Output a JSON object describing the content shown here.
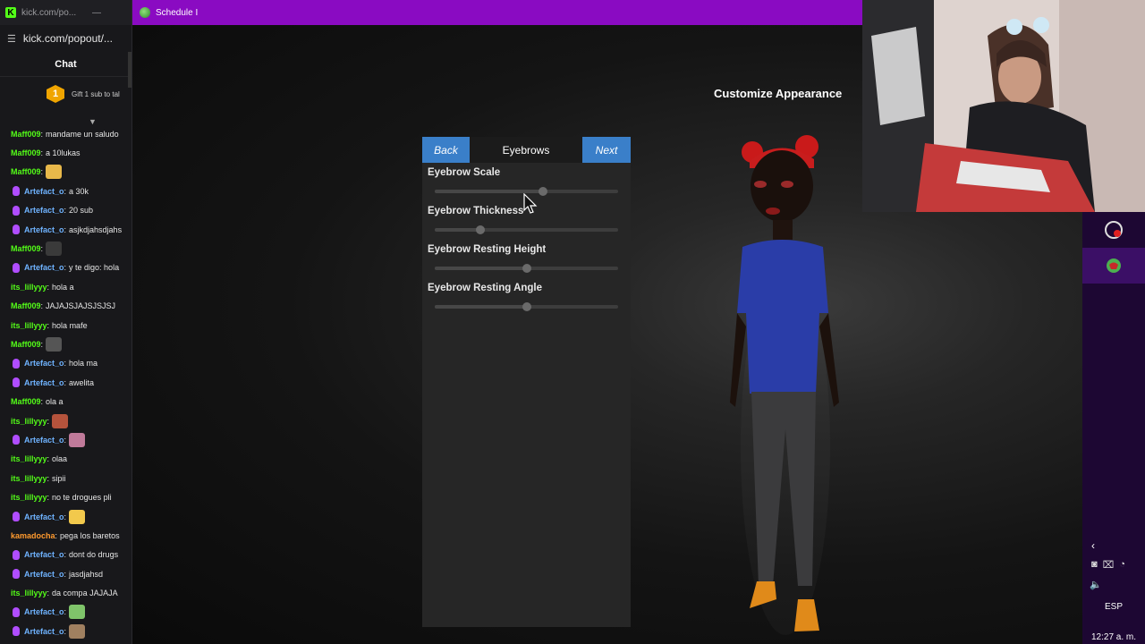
{
  "chat_window": {
    "title": "kick.com/po...",
    "minimize": "—",
    "url": "kick.com/popout/...",
    "header": "Chat",
    "gift": {
      "count": "1",
      "text": "Gift 1 sub to tal"
    },
    "messages": [
      {
        "user": "Maff009",
        "color": "#53fc18",
        "mic": false,
        "text": "mandame un saludo",
        "emote": null
      },
      {
        "user": "Maff009",
        "color": "#53fc18",
        "mic": false,
        "text": "a 10lukas",
        "emote": null
      },
      {
        "user": "Maff009",
        "color": "#53fc18",
        "mic": false,
        "text": "",
        "emote": "#e8b84a"
      },
      {
        "user": "Artefact_o",
        "color": "#6fb3ff",
        "mic": true,
        "text": "a 30k",
        "emote": null
      },
      {
        "user": "Artefact_o",
        "color": "#6fb3ff",
        "mic": true,
        "text": "20 sub",
        "emote": null
      },
      {
        "user": "Artefact_o",
        "color": "#6fb3ff",
        "mic": true,
        "text": "asjkdjahsdjahs",
        "emote": null
      },
      {
        "user": "Maff009",
        "color": "#53fc18",
        "mic": false,
        "text": "",
        "emote": "#3a3a3a"
      },
      {
        "user": "Artefact_o",
        "color": "#6fb3ff",
        "mic": true,
        "text": "y te digo: hola",
        "emote": null
      },
      {
        "user": "its_lillyyy",
        "color": "#53fc18",
        "mic": false,
        "text": "hola a",
        "emote": null
      },
      {
        "user": "Maff009",
        "color": "#53fc18",
        "mic": false,
        "text": "JAJAJSJAJSJSJSJ",
        "emote": null
      },
      {
        "user": "its_lillyyy",
        "color": "#53fc18",
        "mic": false,
        "text": "hola mafe",
        "emote": null
      },
      {
        "user": "Maff009",
        "color": "#53fc18",
        "mic": false,
        "text": "",
        "emote": "#555555"
      },
      {
        "user": "Artefact_o",
        "color": "#6fb3ff",
        "mic": true,
        "text": "hola ma",
        "emote": null
      },
      {
        "user": "Artefact_o",
        "color": "#6fb3ff",
        "mic": true,
        "text": "awelita",
        "emote": null
      },
      {
        "user": "Maff009",
        "color": "#53fc18",
        "mic": false,
        "text": "ola a",
        "emote": null
      },
      {
        "user": "its_lillyyy",
        "color": "#53fc18",
        "mic": false,
        "text": "",
        "emote": "#b5533c"
      },
      {
        "user": "Artefact_o",
        "color": "#6fb3ff",
        "mic": true,
        "text": "",
        "emote": "#c07a9a"
      },
      {
        "user": "its_lillyyy",
        "color": "#53fc18",
        "mic": false,
        "text": "olaa",
        "emote": null
      },
      {
        "user": "its_lillyyy",
        "color": "#53fc18",
        "mic": false,
        "text": "sipii",
        "emote": null
      },
      {
        "user": "its_lillyyy",
        "color": "#53fc18",
        "mic": false,
        "text": "no te drogues pli",
        "emote": null
      },
      {
        "user": "Artefact_o",
        "color": "#6fb3ff",
        "mic": true,
        "text": "",
        "emote": "#f2c94c"
      },
      {
        "user": "kamadocha",
        "color": "#ff9a2e",
        "mic": false,
        "text": "pega los baretos",
        "emote": null
      },
      {
        "user": "Artefact_o",
        "color": "#6fb3ff",
        "mic": true,
        "text": "dont do drugs",
        "emote": null
      },
      {
        "user": "Artefact_o",
        "color": "#6fb3ff",
        "mic": true,
        "text": "jasdjahsd",
        "emote": null
      },
      {
        "user": "its_lillyyy",
        "color": "#53fc18",
        "mic": false,
        "text": "da compa JAJAJA",
        "emote": null
      },
      {
        "user": "Artefact_o",
        "color": "#6fb3ff",
        "mic": true,
        "text": "",
        "emote": "#7fc46a"
      },
      {
        "user": "Artefact_o",
        "color": "#6fb3ff",
        "mic": true,
        "text": "",
        "emote": "#a08060"
      }
    ]
  },
  "game_window": {
    "title": "Schedule I",
    "titlebar_color": "#8a0bc2",
    "customize_title": "Customize Appearance",
    "panel": {
      "back_label": "Back",
      "title": "Eyebrows",
      "next_label": "Next",
      "sliders": [
        {
          "label": "Eyebrow Scale",
          "value": 0.59
        },
        {
          "label": "Eyebrow Thickness",
          "value": 0.25
        },
        {
          "label": "Eyebrow Resting Height",
          "value": 0.5
        },
        {
          "label": "Eyebrow Resting Angle",
          "value": 0.5
        }
      ]
    }
  },
  "taskbar": {
    "bg_color": "#1d0733",
    "language": "ESP",
    "clock": "12:27 a. m."
  },
  "icons": {
    "logo": "kick-logo-icon",
    "cursor": "mouse-cursor-icon",
    "tray": [
      "chevron-left-icon",
      "camera-icon",
      "network-icon",
      "wifi-icon",
      "volume-icon"
    ]
  }
}
